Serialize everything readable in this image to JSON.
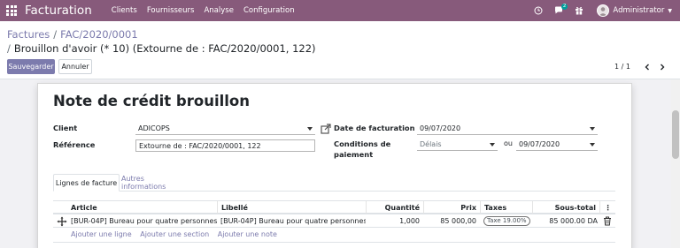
{
  "navbar": {
    "brand": "Facturation",
    "menus": [
      "Clients",
      "Fournisseurs",
      "Analyse",
      "Configuration"
    ],
    "chat_badge": "2",
    "user": "Administrator",
    "icons": [
      "apps-grid-icon",
      "clock-icon",
      "chat-icon",
      "gift-icon",
      "avatar-icon",
      "caret-down-icon"
    ]
  },
  "breadcrumb": {
    "item1": "Factures",
    "item2": "FAC/2020/0001",
    "current": "Brouillon d'avoir (* 10) (Extourne de : FAC/2020/0001, 122)"
  },
  "buttons": {
    "save": "Sauvegarder",
    "discard": "Annuler"
  },
  "pager": {
    "value": "1 / 1"
  },
  "form": {
    "title": "Note de crédit brouillon",
    "client_label": "Client",
    "client_value": "ADICOPS",
    "reference_label": "Référence",
    "reference_value": "Extourne de : FAC/2020/0001, 122",
    "invoice_date_label": "Date de facturation",
    "invoice_date_value": "09/07/2020",
    "payment_terms_label": "Conditions de paiement",
    "payment_terms_value": "Délais",
    "or_label": "ou",
    "due_date_value": "09/07/2020"
  },
  "tabs": [
    "Lignes de facture",
    "Autres informations"
  ],
  "table": {
    "headers": {
      "article": "Article",
      "label": "Libellé",
      "quantity": "Quantité",
      "price": "Prix",
      "taxes": "Taxes",
      "subtotal": "Sous-total",
      "options": "⋮"
    },
    "rows": [
      {
        "article": "[BUR-04P] Bureau pour quatre personnes",
        "label": "[BUR-04P] Bureau pour quatre personnes",
        "quantity": "1,000",
        "price": "85 000,00",
        "tax": "Taxe 19.00%",
        "subtotal": "85 000.00 DA"
      }
    ],
    "add_line": "Ajouter une ligne",
    "add_section": "Ajouter une section",
    "add_note": "Ajouter une note"
  },
  "colors": {
    "navbar": "#875a7b",
    "primary": "#7c7bad",
    "badge": "#00a09d"
  }
}
